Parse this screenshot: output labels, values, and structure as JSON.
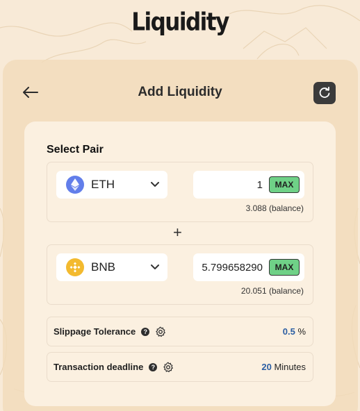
{
  "app": {
    "title": "Liquidity"
  },
  "header": {
    "title": "Add Liquidity"
  },
  "form": {
    "section_label": "Select Pair",
    "plus_symbol": "+",
    "token_a": {
      "symbol": "ETH",
      "amount": "1",
      "max_label": "MAX",
      "balance": "3.088 (balance)"
    },
    "token_b": {
      "symbol": "BNB",
      "amount": "5.799658290",
      "max_label": "MAX",
      "balance": "20.051 (balance)"
    }
  },
  "settings": {
    "slippage": {
      "label": "Slippage Tolerance",
      "value": "0.5",
      "unit": "%"
    },
    "deadline": {
      "label": "Transaction deadline",
      "value": "20",
      "unit": "Minutes"
    }
  },
  "icons": {
    "back": "arrow-left-icon",
    "refresh": "refresh-icon",
    "eth": "ethereum-icon",
    "bnb": "bnb-icon",
    "chevron": "chevron-down-icon",
    "help": "help-icon",
    "gear": "gear-icon"
  },
  "colors": {
    "background": "#f8ead7",
    "outer_card": "#f2dcbb",
    "inner_card": "#fbf0e0",
    "max_button": "#6fd187",
    "value_highlight": "#2b5ea3",
    "eth_icon": "#627eea",
    "bnb_icon": "#f3ba2f",
    "refresh_button": "#3b3b3b"
  }
}
